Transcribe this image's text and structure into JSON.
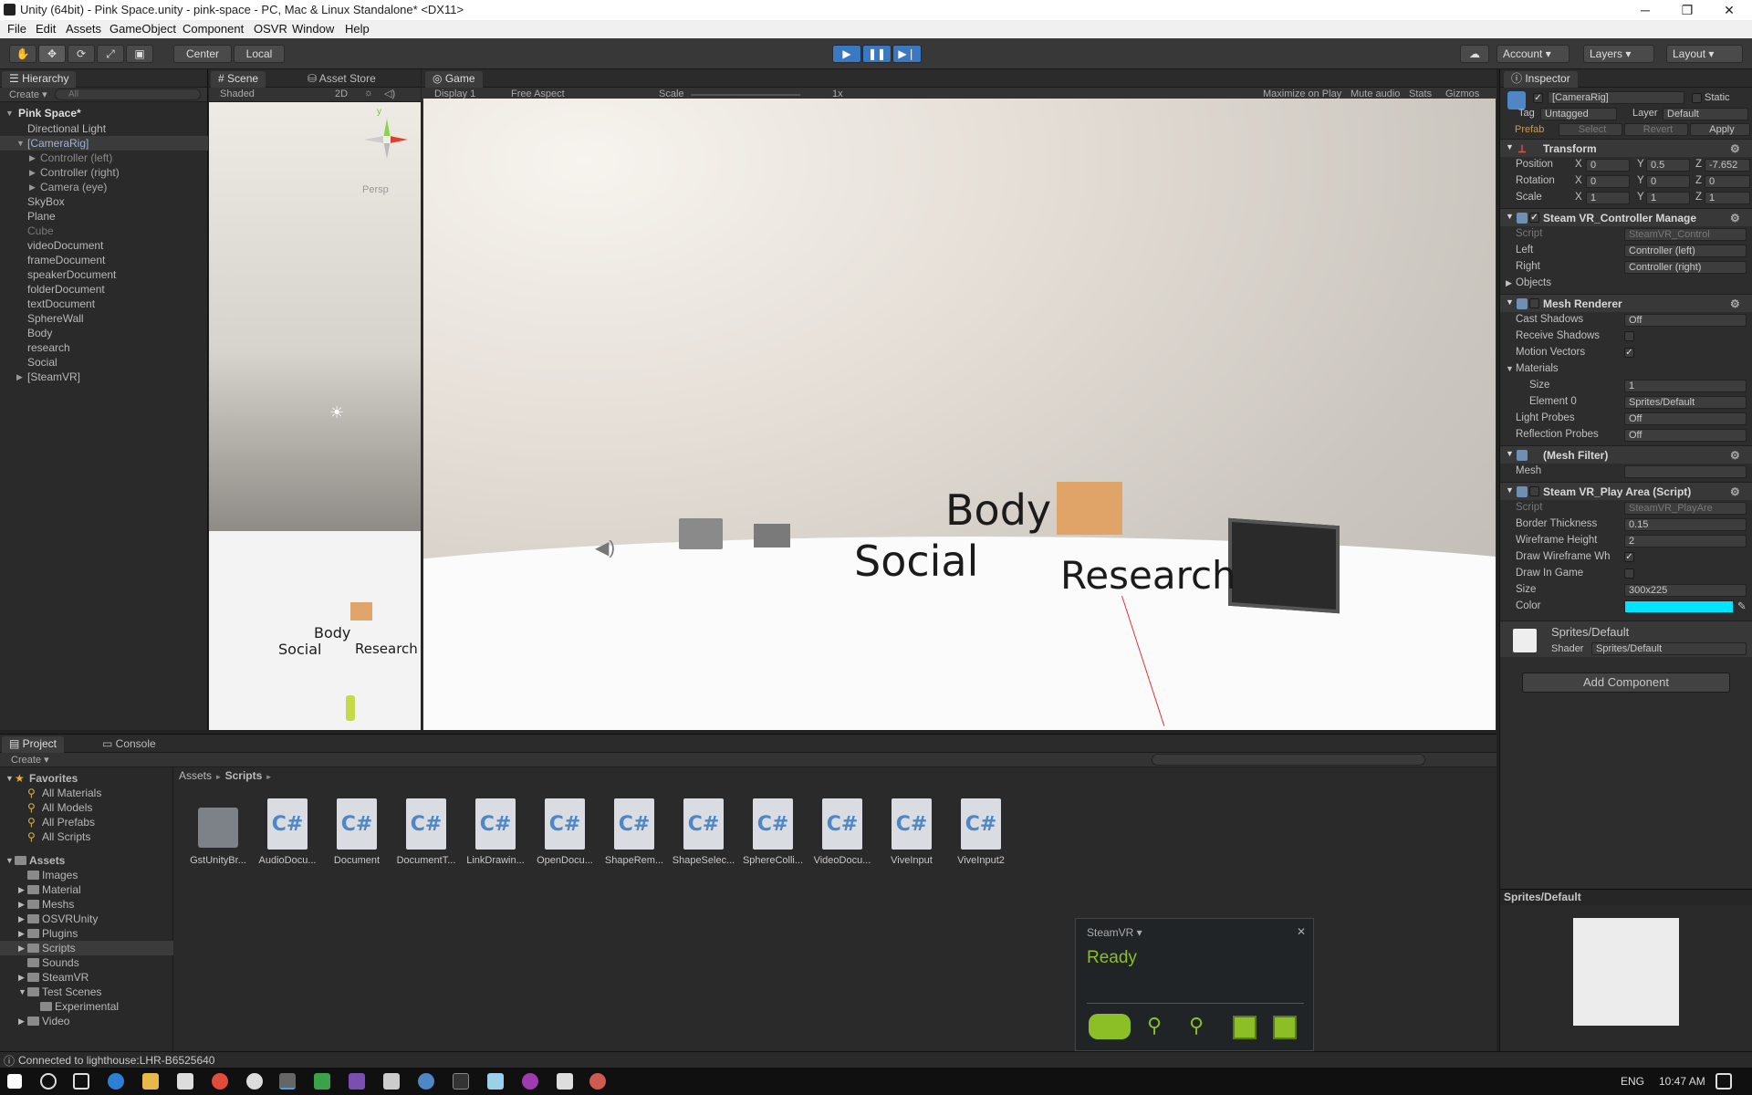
{
  "window": {
    "title": "Unity (64bit) - Pink Space.unity - pink-space - PC, Mac & Linux Standalone* <DX11>",
    "minimize": "─",
    "maximize": "❐",
    "close": "✕"
  },
  "menu": [
    "File",
    "Edit",
    "Assets",
    "GameObject",
    "Component",
    "OSVR",
    "Window",
    "Help"
  ],
  "toolbar": {
    "center": "Center",
    "local": "Local",
    "account": "Account",
    "layers": "Layers",
    "layout": "Layout"
  },
  "hierarchy": {
    "tab": "Hierarchy",
    "create": "Create",
    "search_placeholder": "All",
    "scene_name": "Pink Space*",
    "items": [
      {
        "label": "Directional Light"
      },
      {
        "label": "[CameraRig]"
      },
      {
        "label": "Controller (left)"
      },
      {
        "label": "Controller (right)"
      },
      {
        "label": "Camera (eye)"
      },
      {
        "label": "SkyBox"
      },
      {
        "label": "Plane"
      },
      {
        "label": "Cube"
      },
      {
        "label": "videoDocument"
      },
      {
        "label": "frameDocument"
      },
      {
        "label": "speakerDocument"
      },
      {
        "label": "folderDocument"
      },
      {
        "label": "textDocument"
      },
      {
        "label": "SphereWall"
      },
      {
        "label": "Body"
      },
      {
        "label": "research"
      },
      {
        "label": "Social"
      },
      {
        "label": "[SteamVR]"
      }
    ]
  },
  "scene": {
    "tab": "Scene",
    "tab2": "Asset Store",
    "shading": "Shaded",
    "mode2d": "2D",
    "persp": "Persp",
    "gizmo_y": "y",
    "labels": {
      "body": "Body",
      "social": "Social",
      "research": "Research"
    }
  },
  "game": {
    "tab": "Game",
    "display": "Display 1",
    "aspect": "Free Aspect",
    "scale_label": "Scale",
    "scale_value": "1x",
    "maximize": "Maximize on Play",
    "mute": "Mute audio",
    "stats": "Stats",
    "gizmos": "Gizmos",
    "labels": {
      "body": "Body",
      "social": "Social",
      "research": "Research"
    }
  },
  "inspector": {
    "tab": "Inspector",
    "object_name": "[CameraRig]",
    "static": "Static",
    "tag_label": "Tag",
    "tag_value": "Untagged",
    "layer_label": "Layer",
    "layer_value": "Default",
    "prefab": "Prefab",
    "select": "Select",
    "revert": "Revert",
    "apply": "Apply",
    "transform": {
      "title": "Transform",
      "position_label": "Position",
      "px": "0",
      "py": "0.5",
      "pz": "-7.652",
      "rotation_label": "Rotation",
      "rx": "0",
      "ry": "0",
      "rz": "0",
      "scale_label": "Scale",
      "sx": "1",
      "sy": "1",
      "sz": "1"
    },
    "controller_manager": {
      "title": "Steam VR_Controller Manage",
      "script_label": "Script",
      "script_value": "SteamVR_Control",
      "left_label": "Left",
      "left_value": "Controller (left)",
      "right_label": "Right",
      "right_value": "Controller (right)",
      "objects_label": "Objects"
    },
    "mesh_renderer": {
      "title": "Mesh Renderer",
      "cast_label": "Cast Shadows",
      "cast_value": "Off",
      "receive_label": "Receive Shadows",
      "motion_label": "Motion Vectors",
      "materials_label": "Materials",
      "size_label": "Size",
      "size_value": "1",
      "element_label": "Element 0",
      "element_value": "Sprites/Default",
      "light_label": "Light Probes",
      "light_value": "Off",
      "refl_label": "Reflection Probes",
      "refl_value": "Off"
    },
    "mesh_filter": {
      "title": "(Mesh Filter)",
      "mesh_label": "Mesh"
    },
    "play_area": {
      "title": "Steam VR_Play Area (Script)",
      "script_label": "Script",
      "script_value": "SteamVR_PlayAre",
      "border_label": "Border Thickness",
      "border_value": "0.15",
      "wire_label": "Wireframe Height",
      "wire_value": "2",
      "draw_label": "Draw Wireframe Wh",
      "ingame_label": "Draw In Game",
      "size_label": "Size",
      "size_value": "300x225",
      "color_label": "Color",
      "color_value": "#00e5ff"
    },
    "material": {
      "name": "Sprites/Default",
      "shader_label": "Shader",
      "shader_value": "Sprites/Default"
    },
    "add_component": "Add Component",
    "preview_title": "Sprites/Default"
  },
  "project": {
    "tab": "Project",
    "tab2": "Console",
    "create": "Create",
    "favorites_label": "Favorites",
    "favorites": [
      {
        "label": "All Materials"
      },
      {
        "label": "All Models"
      },
      {
        "label": "All Prefabs"
      },
      {
        "label": "All Scripts"
      }
    ],
    "assets_label": "Assets",
    "folders": [
      {
        "label": "Images"
      },
      {
        "label": "Material"
      },
      {
        "label": "Meshs"
      },
      {
        "label": "OSVRUnity"
      },
      {
        "label": "Plugins"
      },
      {
        "label": "Scripts"
      },
      {
        "label": "Sounds"
      },
      {
        "label": "SteamVR"
      },
      {
        "label": "Test Scenes"
      },
      {
        "label": "Experimental"
      },
      {
        "label": "Video"
      }
    ],
    "breadcrumb": {
      "root": "Assets",
      "sep": "►",
      "current": "Scripts"
    },
    "cs_glyph": "C#",
    "files": [
      {
        "label": "GstUnityBr..."
      },
      {
        "label": "AudioDocu..."
      },
      {
        "label": "Document"
      },
      {
        "label": "DocumentT..."
      },
      {
        "label": "LinkDrawin..."
      },
      {
        "label": "OpenDocu..."
      },
      {
        "label": "ShapeRem..."
      },
      {
        "label": "ShapeSelec..."
      },
      {
        "label": "SphereColli..."
      },
      {
        "label": "VideoDocu..."
      },
      {
        "label": "ViveInput"
      },
      {
        "label": "ViveInput2"
      }
    ]
  },
  "steamvr": {
    "title": "SteamVR ▾",
    "status": "Ready",
    "close": "✕",
    "accent": "#8cbf26"
  },
  "statusbar": {
    "message": "Connected to lighthouse:LHR-B6525640"
  },
  "taskbar": {
    "lang": "ENG",
    "time": "10:47 AM"
  }
}
